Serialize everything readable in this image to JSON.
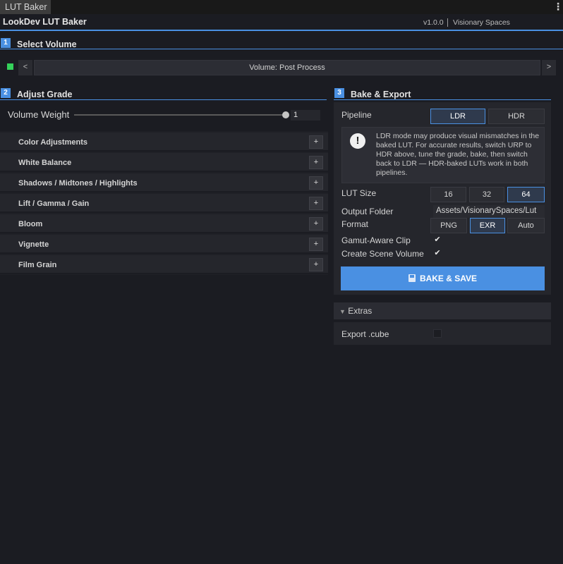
{
  "window": {
    "tab_title": "LUT Baker",
    "menu_icon": "ellipsis-vertical-icon"
  },
  "header": {
    "title": "LookDev LUT Baker",
    "version": "v1.0.0",
    "brand": "Visionary Spaces"
  },
  "sections": {
    "select_volume": {
      "number": "1",
      "title": "Select Volume"
    },
    "adjust_grade": {
      "number": "2",
      "title": "Adjust Grade"
    },
    "bake_export": {
      "number": "3",
      "title": "Bake & Export"
    }
  },
  "volume": {
    "swatch_color": "#35d15a",
    "prev": "<",
    "next": ">",
    "selected": "Volume: Post Process"
  },
  "grade": {
    "weight_label": "Volume Weight",
    "weight_value": "1",
    "weight_fraction": 1.0,
    "rows": [
      {
        "label": "Color Adjustments",
        "button": "+"
      },
      {
        "label": "White Balance",
        "button": "+"
      },
      {
        "label": "Shadows / Midtones / Highlights",
        "button": "+"
      },
      {
        "label": "Lift / Gamma / Gain",
        "button": "+"
      },
      {
        "label": "Bloom",
        "button": "+"
      },
      {
        "label": "Vignette",
        "button": "+"
      },
      {
        "label": "Film Grain",
        "button": "+"
      }
    ]
  },
  "bake": {
    "pipeline_label": "Pipeline",
    "pipeline_options": [
      "LDR",
      "HDR"
    ],
    "pipeline_selected": "LDR",
    "info_icon": "exclamation-icon",
    "info_text": "LDR mode may produce visual mismatches in the baked LUT. For accurate results, switch URP to HDR above, tune the grade, bake, then switch back to LDR — HDR-baked LUTs work in both pipelines.",
    "lut_size_label": "LUT Size",
    "lut_sizes": [
      "16",
      "32",
      "64"
    ],
    "lut_size_selected": "64",
    "output_folder_label": "Output Folder",
    "output_folder_value": "Assets/VisionarySpaces/Lut",
    "format_label": "Format",
    "formats": [
      "PNG",
      "EXR",
      "Auto"
    ],
    "format_selected": "EXR",
    "gamut_label": "Gamut-Aware Clip",
    "gamut_checked": true,
    "create_volume_label": "Create Scene Volume",
    "create_volume_checked": true,
    "check_glyph": "✔",
    "bake_button": "BAKE & SAVE",
    "bake_icon": "floppy-disk-icon",
    "accent_color": "#4a90e2"
  },
  "extras": {
    "arrow": "▼",
    "title": "Extras",
    "export_cube_label": "Export .cube",
    "export_cube_checked": false
  }
}
